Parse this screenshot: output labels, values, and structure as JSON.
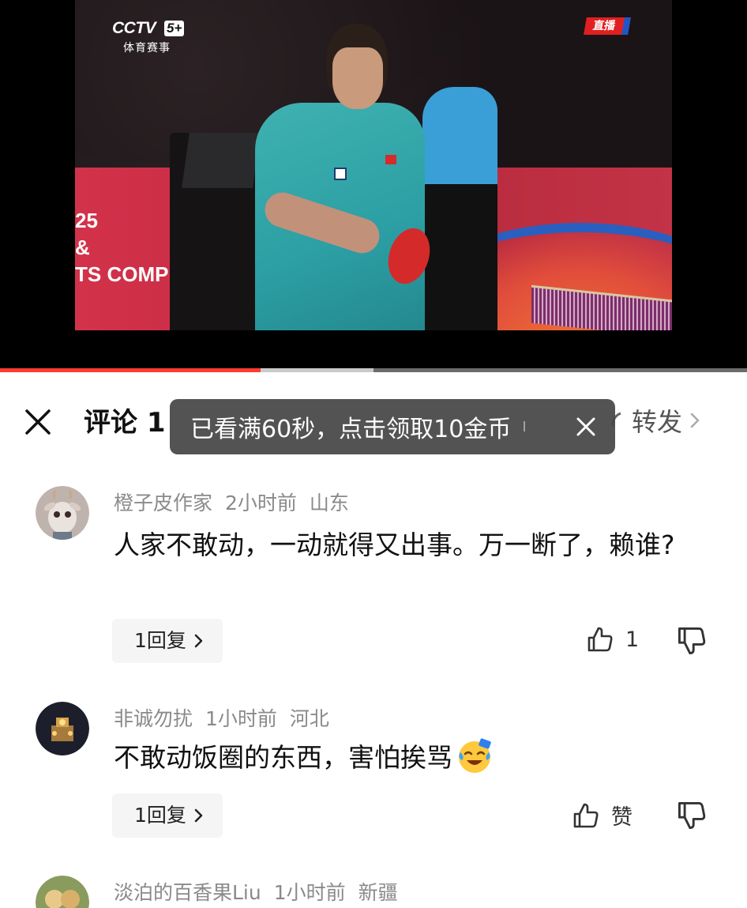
{
  "video": {
    "channel_logo": "CCTV",
    "channel_number": "5+",
    "channel_subtitle": "体育赛事",
    "live_badge": "直播",
    "arena_text": [
      "25",
      "&",
      "TS COMPL"
    ],
    "progress_fraction": 0.3486,
    "buffer_fraction": 0.5,
    "colors": {
      "progress": "#ff3b30",
      "live": "#e02020"
    }
  },
  "header": {
    "close_icon": "close-icon",
    "title": "评论 1",
    "forward_label": "转发"
  },
  "toast": {
    "text": "已看满60秒，点击领取10金币",
    "separator": "I",
    "close_icon": "close-icon"
  },
  "comments": [
    {
      "username": "橙子皮作家",
      "time": "2小时前",
      "location": "山东",
      "text": "人家不敢动，一动就得又出事。万一断了，赖谁?",
      "reply_label": "1回复",
      "like_count": "1",
      "avatar": "goat-avatar"
    },
    {
      "username": "非诚勿扰",
      "time": "1小时前",
      "location": "河北",
      "text": "不敢动饭圈的东西，害怕挨骂",
      "emoji": "laughing-crying-emoji",
      "reply_label": "1回复",
      "like_count": "赞",
      "avatar": "candle-avatar"
    },
    {
      "username": "淡泊的百香果Liu",
      "time": "1小时前",
      "location": "新疆",
      "avatar": "fruit-avatar"
    }
  ]
}
